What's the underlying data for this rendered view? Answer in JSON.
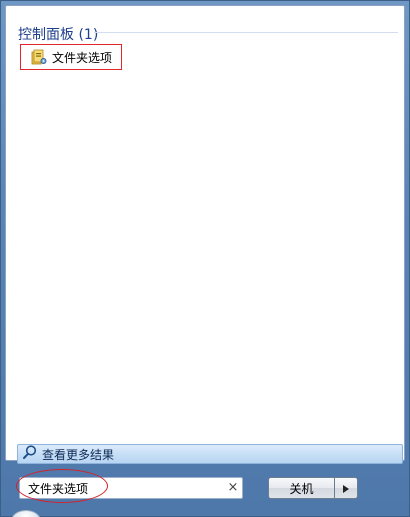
{
  "results": {
    "group_title": "控制面板 (1)",
    "items": [
      {
        "label": "文件夹选项",
        "icon": "folder-options-icon"
      }
    ]
  },
  "more_results": {
    "label": "查看更多结果",
    "icon": "search-icon"
  },
  "search": {
    "value": "文件夹选项",
    "clear_glyph": "×"
  },
  "shutdown": {
    "label": "关机",
    "arrow_icon": "arrow-right-icon"
  },
  "colors": {
    "group_header_text": "#1e3f8c",
    "highlight_red": "#e2262b",
    "frame_blue": "#5b84b6"
  }
}
